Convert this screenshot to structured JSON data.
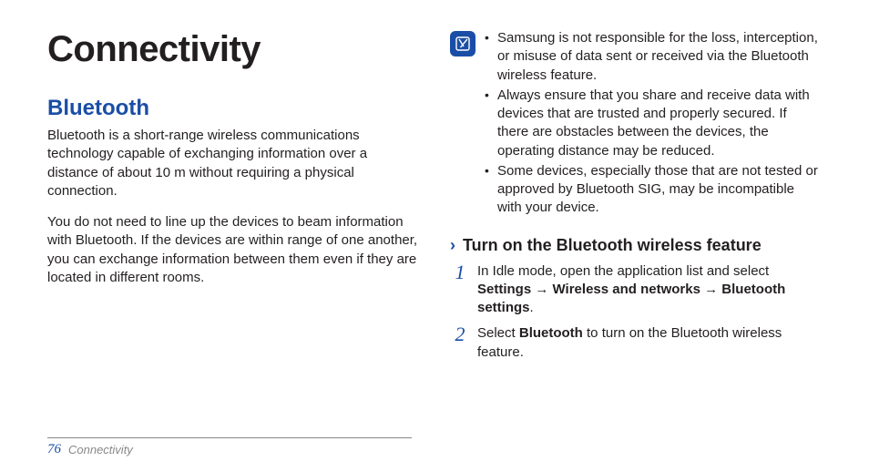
{
  "page_title": "Connectivity",
  "col_left": {
    "section_title": "Bluetooth",
    "para1": "Bluetooth is a short-range wireless communications technology capable of exchanging information over a distance of about 10 m without requiring a physical connection.",
    "para2": "You do not need to line up the devices to beam information with Bluetooth. If the devices are within range of one another, you can exchange information between them even if they are located in different rooms."
  },
  "col_right": {
    "notes": [
      "Samsung is not responsible for the loss, interception, or misuse of data sent or received via the Bluetooth wireless feature.",
      "Always ensure that you share and receive data with devices that are trusted and properly secured. If there are obstacles between the devices, the operating distance may be reduced.",
      "Some devices, especially those that are not tested or approved by Bluetooth SIG, may be incompatible with your device."
    ],
    "sub_heading": "Turn on the Bluetooth wireless feature",
    "steps": {
      "s1_pre": "In Idle mode, open the application list and select ",
      "s1_b1": "Settings",
      "s1_arrow": " → ",
      "s1_b2": "Wireless and networks",
      "s1_b3": "Bluetooth settings",
      "s1_post": ".",
      "s2_pre": "Select ",
      "s2_b1": "Bluetooth",
      "s2_post": " to turn on the Bluetooth wireless feature."
    }
  },
  "footer": {
    "page_number": "76",
    "section_label": "Connectivity"
  }
}
